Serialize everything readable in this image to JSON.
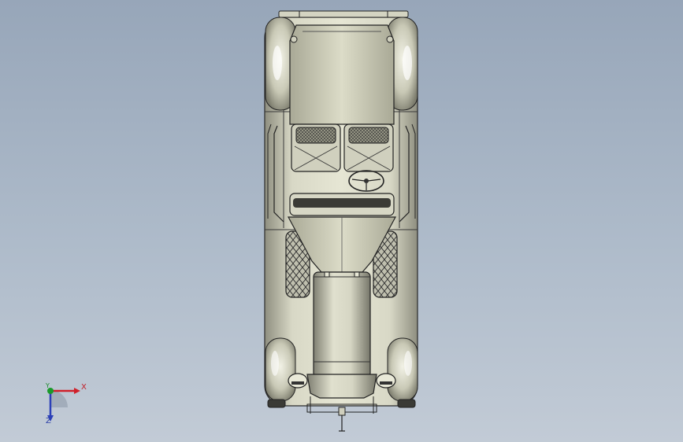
{
  "viewport": {
    "background_top": "#97a6b9",
    "background_bottom": "#c2cbd6",
    "model_fill": "#cfcfbd",
    "model_stroke": "#2a2a2a"
  },
  "triad": {
    "x_label": "X",
    "y_label": "Y",
    "z_label": "Z",
    "x_color": "#d0202a",
    "y_color": "#1a9a2a",
    "z_color": "#2b3fb8"
  }
}
